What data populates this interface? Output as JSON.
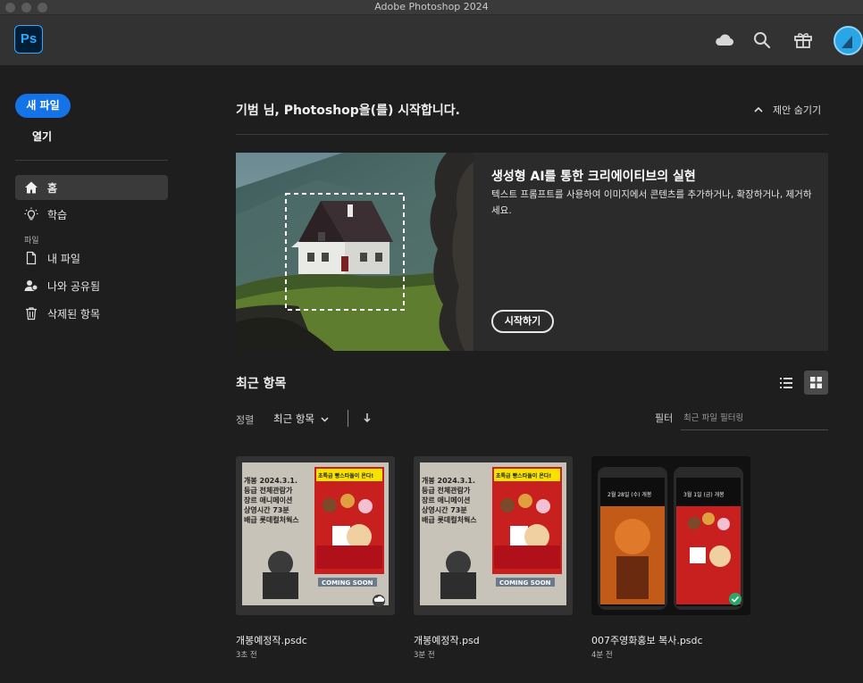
{
  "window": {
    "title": "Adobe Photoshop 2024"
  },
  "header": {
    "logo_text": "Ps",
    "icons": [
      "cloud-icon",
      "search-icon",
      "gift-icon",
      "avatar"
    ]
  },
  "sidebar": {
    "new_file": "새 파일",
    "open": "열기",
    "items": [
      {
        "label": "홈",
        "icon": "home-icon",
        "active": true
      },
      {
        "label": "학습",
        "icon": "lightbulb-icon",
        "active": false
      }
    ],
    "section_files": "파일",
    "file_items": [
      {
        "label": "내 파일",
        "icon": "file-icon"
      },
      {
        "label": "나와 공유됨",
        "icon": "shared-user-icon"
      },
      {
        "label": "삭제된 항목",
        "icon": "trash-icon"
      }
    ]
  },
  "main": {
    "greeting": "기범 님, Photoshop을(를) 시작합니다.",
    "hide_suggestions": "제안 숨기기",
    "banner": {
      "title": "생성형 AI를 통한 크리에이티브의 실현",
      "description": "텍스트 프롬프트를 사용하여 이미지에서 콘텐츠를 추가하거나, 확장하거나, 제거하세요.",
      "button": "시작하기"
    },
    "recent": {
      "title": "최근 항목",
      "sort_label": "정렬",
      "sort_value": "최근 항목",
      "filter_label": "필터",
      "filter_placeholder": "최근 파일 필터링",
      "files": [
        {
          "name": "개봉예정작.psdc",
          "time": "3초 전",
          "badge": "cloud-icon"
        },
        {
          "name": "개봉예정작.psd",
          "time": "3분 전",
          "badge": ""
        },
        {
          "name": "007주영화홍보 복사.psdc",
          "time": "4분 전",
          "badge": "check-icon"
        }
      ],
      "poster_text": {
        "line1": "개봉 2024.3.1.",
        "line2": "등급 전체관람가",
        "line3": "장르 애니메이션",
        "line4": "상영시간 73분",
        "line5": "배급 롯데컬처웍스",
        "tag": "초특급 빵스타들이 온다!",
        "coming": "COMING SOON",
        "phone1_date": "2월 28일 (수) 개봉",
        "phone2_date": "3월 1일 (금) 개봉"
      }
    }
  },
  "colors": {
    "accent": "#1473e6",
    "ps_blue": "#31a8ff",
    "background": "#1e1e1e",
    "header": "#323232"
  }
}
